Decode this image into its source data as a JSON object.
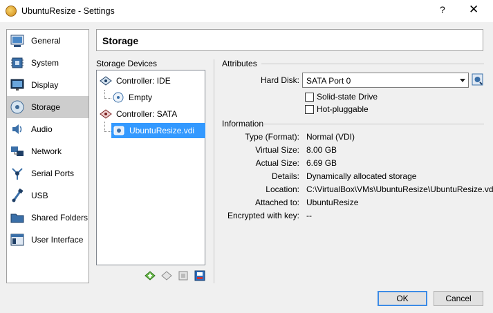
{
  "window": {
    "title": "UbuntuResize - Settings",
    "help_glyph": "?",
    "close_glyph": "✕"
  },
  "sidebar": {
    "items": [
      {
        "label": "General",
        "icon": "general-icon"
      },
      {
        "label": "System",
        "icon": "system-icon"
      },
      {
        "label": "Display",
        "icon": "display-icon"
      },
      {
        "label": "Storage",
        "icon": "storage-icon",
        "selected": true
      },
      {
        "label": "Audio",
        "icon": "audio-icon"
      },
      {
        "label": "Network",
        "icon": "network-icon"
      },
      {
        "label": "Serial Ports",
        "icon": "serial-ports-icon"
      },
      {
        "label": "USB",
        "icon": "usb-icon"
      },
      {
        "label": "Shared Folders",
        "icon": "shared-folders-icon"
      },
      {
        "label": "User Interface",
        "icon": "user-interface-icon"
      }
    ]
  },
  "page": {
    "title": "Storage"
  },
  "storage_devices": {
    "label": "Storage Devices",
    "tree": [
      {
        "label": "Controller: IDE",
        "icon": "ide-controller-icon"
      },
      {
        "label": "Empty",
        "icon": "optical-disc-icon"
      },
      {
        "label": "Controller: SATA",
        "icon": "sata-controller-icon"
      },
      {
        "label": "UbuntuResize.vdi",
        "icon": "hard-disk-icon",
        "selected": true
      }
    ],
    "tools": [
      "add-attachment-icon",
      "remove-attachment-icon",
      "add-controller-icon",
      "remove-controller-icon"
    ]
  },
  "attributes": {
    "header": "Attributes",
    "hard_disk_label": "Hard Disk:",
    "hard_disk_value": "SATA Port 0",
    "solid_state_label": "Solid-state Drive",
    "hot_pluggable_label": "Hot-pluggable"
  },
  "information": {
    "header": "Information",
    "rows": [
      {
        "label": "Type (Format):",
        "value": "Normal (VDI)"
      },
      {
        "label": "Virtual Size:",
        "value": "8.00 GB"
      },
      {
        "label": "Actual Size:",
        "value": "6.69 GB"
      },
      {
        "label": "Details:",
        "value": "Dynamically allocated storage"
      },
      {
        "label": "Location:",
        "value": "C:\\VirtualBox\\VMs\\UbuntuResize\\UbuntuResize.vdi"
      },
      {
        "label": "Attached to:",
        "value": "UbuntuResize"
      },
      {
        "label": "Encrypted with key:",
        "value": "--"
      }
    ]
  },
  "buttons": {
    "ok": "OK",
    "cancel": "Cancel"
  }
}
